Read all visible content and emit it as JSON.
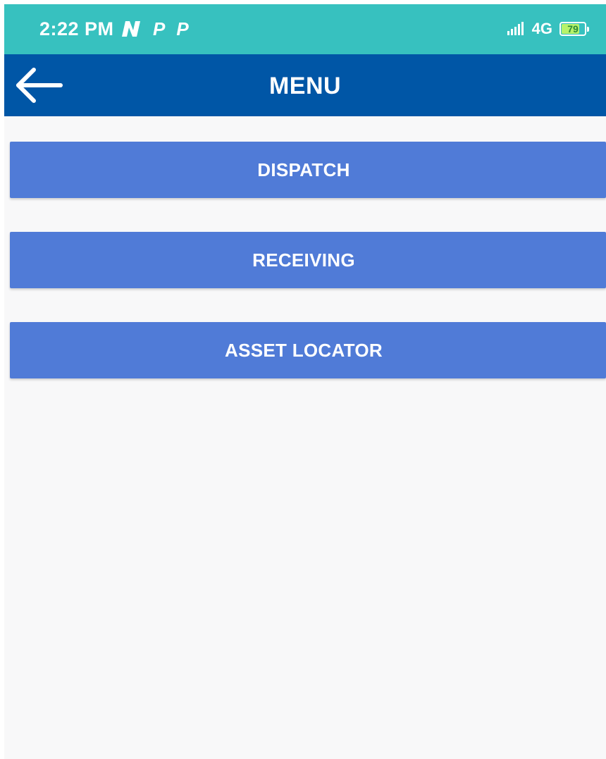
{
  "status_bar": {
    "time": "2:22 PM",
    "notification_icons": [
      "n-app-icon",
      "p-app-icon",
      "p-app-icon"
    ],
    "p_glyph": "P",
    "network": "4G",
    "battery_percent": "79",
    "battery_level": 0.79
  },
  "app_bar": {
    "title": "MENU",
    "back_icon": "arrow-left-icon"
  },
  "menu": {
    "items": [
      {
        "label": "DISPATCH"
      },
      {
        "label": "RECEIVING"
      },
      {
        "label": "ASSET LOCATOR"
      }
    ]
  },
  "colors": {
    "status_bar": "#37c1bf",
    "app_bar": "#0056a6",
    "button": "#507bd7",
    "background": "#f8f8f9"
  }
}
